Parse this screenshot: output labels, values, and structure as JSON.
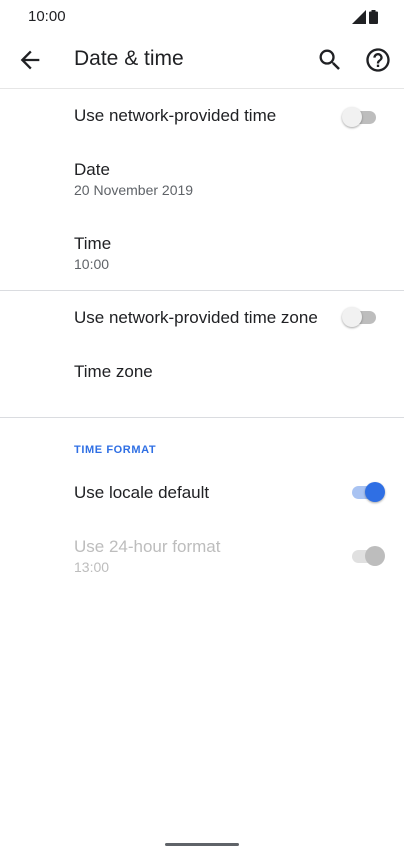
{
  "status_bar": {
    "time": "10:00"
  },
  "toolbar": {
    "title": "Date & time"
  },
  "settings": {
    "network_time": {
      "title": "Use network-provided time",
      "enabled": false
    },
    "date": {
      "title": "Date",
      "summary": "20 November 2019"
    },
    "time": {
      "title": "Time",
      "summary": "10:00"
    },
    "network_time_zone": {
      "title": "Use network-provided time zone",
      "enabled": false
    },
    "time_zone": {
      "title": "Time zone"
    },
    "time_format_header": "TIME FORMAT",
    "locale_default": {
      "title": "Use locale default",
      "enabled": true
    },
    "hour24": {
      "title": "Use 24-hour format",
      "summary": "13:00",
      "enabled": true,
      "disabled": true
    }
  },
  "colors": {
    "accent": "#2f6fe4",
    "text_primary": "#202124",
    "text_secondary": "#5f6368",
    "disabled": "#bdbdbd"
  }
}
